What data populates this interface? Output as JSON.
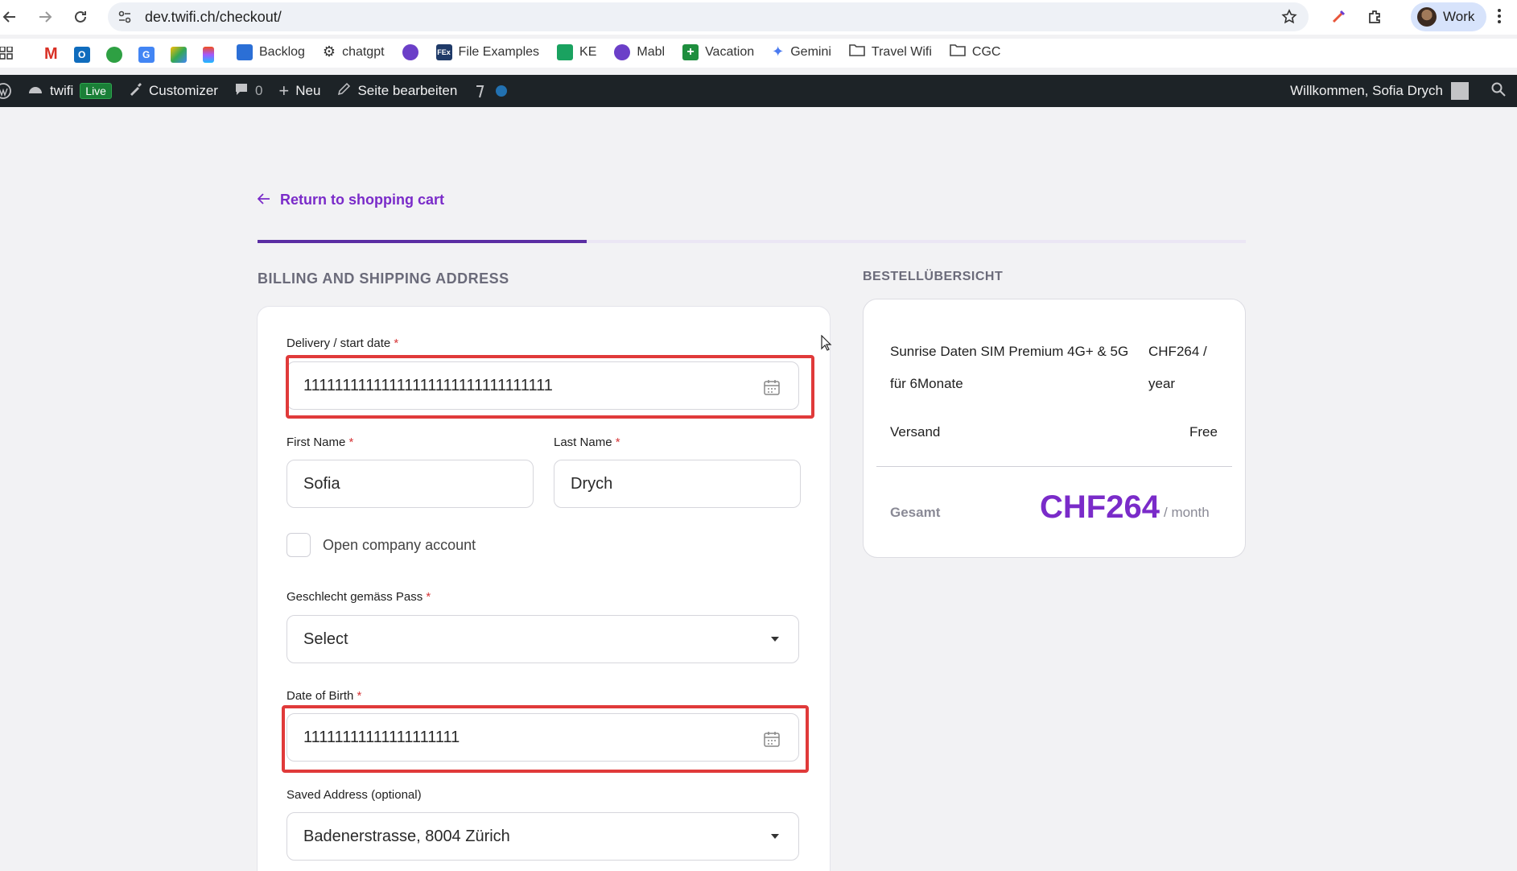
{
  "browser": {
    "url": "dev.twifi.ch/checkout/",
    "profile_label": "Work"
  },
  "bookmarks": [
    {
      "label": "Backlog",
      "icon": "backlog-icon",
      "color": "#2b6fd6"
    },
    {
      "label": "chatgpt",
      "icon": "chatgpt-icon",
      "color": "#333333"
    },
    {
      "label": "File Examples",
      "icon": "file-examples-icon",
      "color": "#1f3a68"
    },
    {
      "label": "KE",
      "icon": "ke-icon",
      "color": "#1aa260"
    },
    {
      "label": "Mabl",
      "icon": "mabl-icon",
      "color": "#6b3fc8"
    },
    {
      "label": "Vacation",
      "icon": "vacation-icon",
      "color": "#1e8e3e"
    },
    {
      "label": "Gemini",
      "icon": "gemini-icon",
      "color": "#4a7af0"
    },
    {
      "label": "Travel Wifi",
      "icon": "folder-icon",
      "color": "#444444"
    },
    {
      "label": "CGC",
      "icon": "folder-icon",
      "color": "#444444"
    }
  ],
  "wpbar": {
    "site": "twifi",
    "live_badge": "Live",
    "customizer": "Customizer",
    "comments_count": "0",
    "new": "Neu",
    "edit_page": "Seite bearbeiten",
    "welcome": "Willkommen, Sofia Drych"
  },
  "checkout": {
    "return_link": "Return to shopping cart",
    "progress_fraction": 0.333,
    "billing_title": "BILLING AND SHIPPING ADDRESS",
    "delivery_label": "Delivery / start date",
    "delivery_value": "11111111111111111111111111111111",
    "first_name_label": "First Name",
    "first_name_value": "Sofia",
    "last_name_label": "Last Name",
    "last_name_value": "Drych",
    "company_account_label": "Open company account",
    "gender_label": "Geschlecht gemäss Pass",
    "gender_value": "Select",
    "dob_label": "Date of Birth",
    "dob_value": "11111111111111111111",
    "saved_address_label": "Saved Address (optional)",
    "saved_address_value": "Badenerstrasse, 8004 Zürich",
    "required_mark": "*"
  },
  "summary": {
    "title": "BESTELLÜBERSICHT",
    "product_line1": "Sunrise Daten SIM Premium 4G+ & 5G",
    "product_line2": "für 6Monate",
    "product_price_line1": "CHF264 /",
    "product_price_line2": "year",
    "shipping_label": "Versand",
    "shipping_value": "Free",
    "total_label": "Gesamt",
    "total_price": "CHF264",
    "total_period": "/ month"
  },
  "colors": {
    "accent": "#7a2bc9",
    "highlight": "#e03a3a",
    "wp_bar": "#1d2327"
  }
}
